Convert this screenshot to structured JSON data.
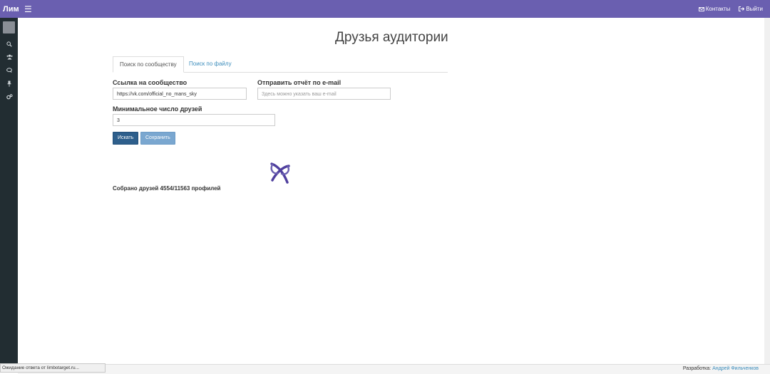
{
  "app": {
    "brand": "Лим"
  },
  "topbar": {
    "menu_icon": "hamburger-icon",
    "contacts_label": "Контакты",
    "contacts_icon": "envelope-icon",
    "logout_label": "Выйти",
    "logout_icon": "sign-out-icon"
  },
  "sidebar": {
    "items": [
      {
        "icon": "search-icon"
      },
      {
        "icon": "users-icon"
      },
      {
        "icon": "comments-icon"
      },
      {
        "icon": "pin-icon"
      },
      {
        "icon": "gears-icon"
      }
    ]
  },
  "main": {
    "title": "Друзья аудитории",
    "tabs": [
      {
        "label": "Поиск по сообществу",
        "active": true
      },
      {
        "label": "Поиск по файлу",
        "active": false
      }
    ],
    "form": {
      "community_label": "Ссылка на сообщество",
      "community_value": "https://vk.com/official_no_mans_sky",
      "email_label": "Отправить отчёт по e-mail",
      "email_placeholder": "Здесь можно указать ваш e-mail",
      "min_friends_label": "Минимальное число друзей",
      "min_friends_value": "3",
      "search_button": "Искать",
      "save_button": "Сохранить"
    },
    "progress_text": "Собрано друзей 4554/11563 профилей"
  },
  "footer": {
    "status_text": "Ожидание ответа от limbotarget.ru...",
    "dev_label": "Разработка:",
    "dev_name": "Андрей Фильченков"
  },
  "colors": {
    "topbar": "#6a5fb0",
    "sidebar": "#222d32",
    "primary_button": "#2e5f8c",
    "secondary_button": "#7aa7d0",
    "link": "#3c8dbc"
  }
}
